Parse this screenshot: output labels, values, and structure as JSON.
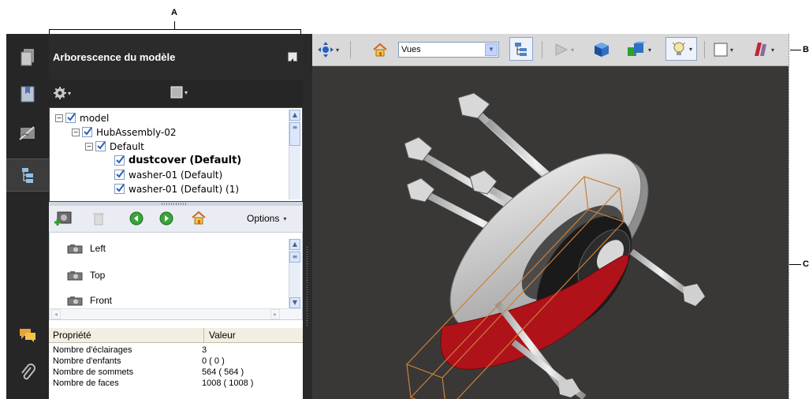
{
  "callouts": {
    "a": "A",
    "b": "B",
    "c": "C"
  },
  "panel": {
    "title": "Arborescence du modèle",
    "tree": [
      {
        "label": "model",
        "bold": false
      },
      {
        "label": "HubAssembly-02",
        "bold": false
      },
      {
        "label": "Default",
        "bold": false
      },
      {
        "label": "dustcover (Default)",
        "bold": true
      },
      {
        "label": "washer-01 (Default)",
        "bold": false
      },
      {
        "label": "washer-01 (Default) (1)",
        "bold": false
      }
    ],
    "views_options_label": "Options",
    "views": [
      "Left",
      "Top",
      "Front"
    ],
    "properties": {
      "header": {
        "property": "Propriété",
        "value": "Valeur"
      },
      "rows": [
        {
          "name": "Nombre d'éclairages",
          "value": "3"
        },
        {
          "name": "Nombre d'enfants",
          "value": "0 ( 0 )"
        },
        {
          "name": "Nombre de sommets",
          "value": "564 ( 564 )"
        },
        {
          "name": "Nombre de faces",
          "value": "1008 ( 1008 )"
        }
      ]
    }
  },
  "toolbar": {
    "views_select_value": "Vues"
  },
  "colors": {
    "rail_bg": "#262626",
    "panel_bg": "#1e1e1e",
    "toolbar_bg": "#d9d9d9",
    "viewport_bg": "#3a3836",
    "part_red": "#b0121a",
    "bbox_orange": "#c9803a"
  },
  "icons": {
    "rail": [
      "pages-icon",
      "bookmarks-icon",
      "signatures-icon",
      "model-tree-icon",
      "comments-icon",
      "attachments-icon"
    ],
    "toolbar": [
      "rotate-tool-icon",
      "home-view-icon",
      "model-tree-toggle-icon",
      "play-animation-icon",
      "projection-icon",
      "render-mode-icon",
      "lighting-icon",
      "background-color-icon",
      "cross-section-icon"
    ]
  }
}
